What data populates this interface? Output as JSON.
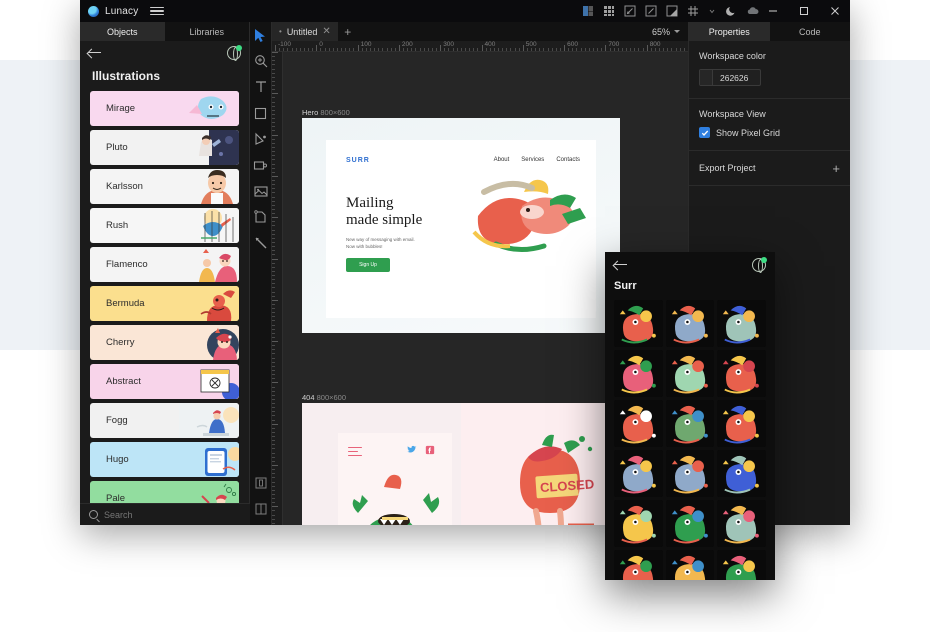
{
  "window": {
    "app_name": "Lunacy",
    "menu_icon": "hamburger-icon",
    "titlebar_icons": [
      "artboard-icon",
      "grid-icon",
      "scale-down-icon",
      "scale-up-icon",
      "contrast-icon",
      "pixel-grid-icon",
      "chevron-down-icon",
      "moon-icon",
      "cloud-icon"
    ],
    "controls": {
      "minimize": "–",
      "maximize": "□",
      "close": "✕"
    }
  },
  "left_panel": {
    "tabs": [
      {
        "label": "Objects",
        "active": true
      },
      {
        "label": "Libraries",
        "active": false
      }
    ],
    "back_icon": "arrow-left-icon",
    "globe_icon": "globe-icon",
    "title": "Illustrations",
    "items": [
      {
        "name": "Mirage",
        "bg": "#f9d9ef"
      },
      {
        "name": "Pluto",
        "bg": "#f2f2f2"
      },
      {
        "name": "Karlsson",
        "bg": "#f4f4f4"
      },
      {
        "name": "Rush",
        "bg": "#f6f6f6"
      },
      {
        "name": "Flamenco",
        "bg": "#f4f4f4"
      },
      {
        "name": "Bermuda",
        "bg": "#fbdf8e"
      },
      {
        "name": "Cherry",
        "bg": "#fae6d6"
      },
      {
        "name": "Abstract",
        "bg": "#f8d4ea"
      },
      {
        "name": "Fogg",
        "bg": "#f1f1f1"
      },
      {
        "name": "Hugo",
        "bg": "#bde5f7"
      },
      {
        "name": "Pale",
        "bg": "#92dd9f"
      }
    ],
    "search": {
      "placeholder": "Search",
      "value": "",
      "icon": "search-icon"
    }
  },
  "toolbar": {
    "tools": [
      {
        "name": "cursor-tool",
        "active": true
      },
      {
        "name": "zoom-tool",
        "active": false
      },
      {
        "name": "text-tool",
        "active": false
      },
      {
        "name": "rectangle-tool",
        "active": false
      },
      {
        "name": "pen-tool",
        "active": false
      },
      {
        "name": "artboard-tool",
        "active": false
      },
      {
        "name": "image-tool",
        "active": false
      },
      {
        "name": "shape-tool",
        "active": false
      },
      {
        "name": "line-tool",
        "active": false
      }
    ],
    "bottom_tools": [
      {
        "name": "panel-layout-single-icon"
      },
      {
        "name": "panel-layout-split-icon"
      }
    ]
  },
  "canvas": {
    "tab": {
      "label": "Untitled",
      "modified_dot": "•",
      "close": "✕"
    },
    "new_tab": "+",
    "zoom": "65%",
    "ruler_labels": [
      "-100",
      "0",
      "100",
      "200",
      "300",
      "400",
      "500",
      "600",
      "700",
      "800"
    ],
    "artboards": [
      {
        "label": "Hero",
        "size": "800×600",
        "content": {
          "logo": "SURR",
          "nav": [
            "About",
            "Services",
            "Contacts"
          ],
          "headline_line1": "Mailing",
          "headline_line2": "made simple",
          "subtext_line1": "New way of messaging with email.",
          "subtext_line2": "Now with bubbles!",
          "cta": "Sign Up",
          "cta_color": "#2f9e4f"
        }
      },
      {
        "label": "404",
        "size": "800×600",
        "content": {
          "social": [
            "twitter-icon",
            "facebook-icon"
          ],
          "menu": "hamburger-icon",
          "sign_text": "CLOSED"
        }
      }
    ]
  },
  "properties": {
    "tabs": [
      {
        "label": "Properties",
        "active": true
      },
      {
        "label": "Code",
        "active": false
      }
    ],
    "sections": [
      {
        "title": "Workspace color",
        "color_value": "262626",
        "swatch": "#262626"
      },
      {
        "title": "Workspace View",
        "checkbox": {
          "label": "Show Pixel Grid",
          "checked": true,
          "color": "#2f7fe0"
        }
      },
      {
        "title": "Export Project",
        "action": "+"
      }
    ]
  },
  "surr_popup": {
    "back_icon": "arrow-left-icon",
    "globe_icon": "globe-icon",
    "title": "Surr",
    "thumb_count": 18
  }
}
